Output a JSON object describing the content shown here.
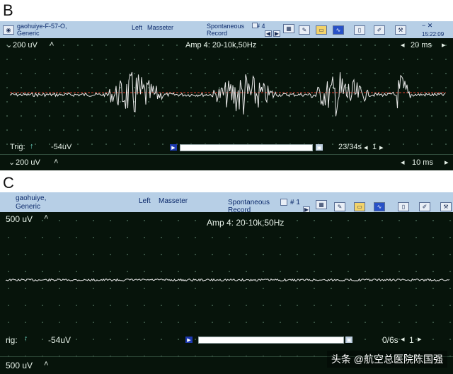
{
  "panel_b": {
    "label": "B",
    "patient": "gaohuiye-F-57-O,",
    "patient2": "Generic",
    "side": "Left",
    "muscle": "Masseter",
    "mode": "Spontaneous",
    "mode2": "Record",
    "channel": "# 4",
    "clock": "15:22:09",
    "gain": "200 uV",
    "timebase": "20 ms",
    "amp": "Amp 4: 20-10k,50Hz",
    "trig_label": "Trig:",
    "trig_value": "-54uV",
    "frame": "23/34s",
    "frame_idx": "1",
    "footer_gain": "200 uV",
    "footer_time": "10 ms"
  },
  "panel_c": {
    "label": "C",
    "patient": "gaohuiye,",
    "patient2": "Generic",
    "side": "Left",
    "muscle": "Masseter",
    "mode": "Spontaneous",
    "mode2": "Record",
    "channel": "# 1",
    "gain": "500 uV",
    "amp": "Amp 4: 20-10k,50Hz",
    "trig_label": "rig:",
    "trig_value": "-54uV",
    "frame": "0/6s",
    "frame_idx": "1",
    "footer_gain": "500 uV"
  },
  "watermark": "头条 @航空总医院陈国强",
  "colors": {
    "trace": "#e8e8e8",
    "reference": "#e23b2b",
    "screen": "#07140b",
    "titlebar": "#b7cfe6"
  }
}
